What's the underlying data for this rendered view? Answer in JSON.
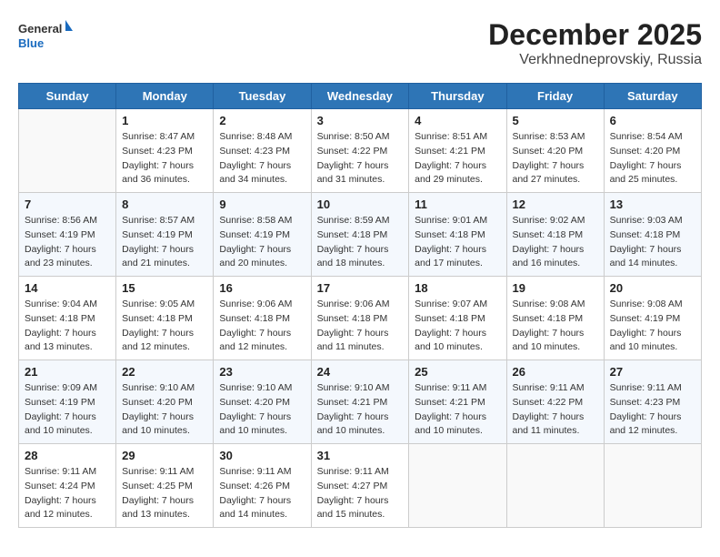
{
  "logo": {
    "general": "General",
    "blue": "Blue"
  },
  "header": {
    "month": "December 2025",
    "location": "Verkhnedneprovskiy, Russia"
  },
  "weekdays": [
    "Sunday",
    "Monday",
    "Tuesday",
    "Wednesday",
    "Thursday",
    "Friday",
    "Saturday"
  ],
  "weeks": [
    [
      {
        "day": "",
        "info": ""
      },
      {
        "day": "1",
        "info": "Sunrise: 8:47 AM\nSunset: 4:23 PM\nDaylight: 7 hours\nand 36 minutes."
      },
      {
        "day": "2",
        "info": "Sunrise: 8:48 AM\nSunset: 4:23 PM\nDaylight: 7 hours\nand 34 minutes."
      },
      {
        "day": "3",
        "info": "Sunrise: 8:50 AM\nSunset: 4:22 PM\nDaylight: 7 hours\nand 31 minutes."
      },
      {
        "day": "4",
        "info": "Sunrise: 8:51 AM\nSunset: 4:21 PM\nDaylight: 7 hours\nand 29 minutes."
      },
      {
        "day": "5",
        "info": "Sunrise: 8:53 AM\nSunset: 4:20 PM\nDaylight: 7 hours\nand 27 minutes."
      },
      {
        "day": "6",
        "info": "Sunrise: 8:54 AM\nSunset: 4:20 PM\nDaylight: 7 hours\nand 25 minutes."
      }
    ],
    [
      {
        "day": "7",
        "info": "Sunrise: 8:56 AM\nSunset: 4:19 PM\nDaylight: 7 hours\nand 23 minutes."
      },
      {
        "day": "8",
        "info": "Sunrise: 8:57 AM\nSunset: 4:19 PM\nDaylight: 7 hours\nand 21 minutes."
      },
      {
        "day": "9",
        "info": "Sunrise: 8:58 AM\nSunset: 4:19 PM\nDaylight: 7 hours\nand 20 minutes."
      },
      {
        "day": "10",
        "info": "Sunrise: 8:59 AM\nSunset: 4:18 PM\nDaylight: 7 hours\nand 18 minutes."
      },
      {
        "day": "11",
        "info": "Sunrise: 9:01 AM\nSunset: 4:18 PM\nDaylight: 7 hours\nand 17 minutes."
      },
      {
        "day": "12",
        "info": "Sunrise: 9:02 AM\nSunset: 4:18 PM\nDaylight: 7 hours\nand 16 minutes."
      },
      {
        "day": "13",
        "info": "Sunrise: 9:03 AM\nSunset: 4:18 PM\nDaylight: 7 hours\nand 14 minutes."
      }
    ],
    [
      {
        "day": "14",
        "info": "Sunrise: 9:04 AM\nSunset: 4:18 PM\nDaylight: 7 hours\nand 13 minutes."
      },
      {
        "day": "15",
        "info": "Sunrise: 9:05 AM\nSunset: 4:18 PM\nDaylight: 7 hours\nand 12 minutes."
      },
      {
        "day": "16",
        "info": "Sunrise: 9:06 AM\nSunset: 4:18 PM\nDaylight: 7 hours\nand 12 minutes."
      },
      {
        "day": "17",
        "info": "Sunrise: 9:06 AM\nSunset: 4:18 PM\nDaylight: 7 hours\nand 11 minutes."
      },
      {
        "day": "18",
        "info": "Sunrise: 9:07 AM\nSunset: 4:18 PM\nDaylight: 7 hours\nand 10 minutes."
      },
      {
        "day": "19",
        "info": "Sunrise: 9:08 AM\nSunset: 4:18 PM\nDaylight: 7 hours\nand 10 minutes."
      },
      {
        "day": "20",
        "info": "Sunrise: 9:08 AM\nSunset: 4:19 PM\nDaylight: 7 hours\nand 10 minutes."
      }
    ],
    [
      {
        "day": "21",
        "info": "Sunrise: 9:09 AM\nSunset: 4:19 PM\nDaylight: 7 hours\nand 10 minutes."
      },
      {
        "day": "22",
        "info": "Sunrise: 9:10 AM\nSunset: 4:20 PM\nDaylight: 7 hours\nand 10 minutes."
      },
      {
        "day": "23",
        "info": "Sunrise: 9:10 AM\nSunset: 4:20 PM\nDaylight: 7 hours\nand 10 minutes."
      },
      {
        "day": "24",
        "info": "Sunrise: 9:10 AM\nSunset: 4:21 PM\nDaylight: 7 hours\nand 10 minutes."
      },
      {
        "day": "25",
        "info": "Sunrise: 9:11 AM\nSunset: 4:21 PM\nDaylight: 7 hours\nand 10 minutes."
      },
      {
        "day": "26",
        "info": "Sunrise: 9:11 AM\nSunset: 4:22 PM\nDaylight: 7 hours\nand 11 minutes."
      },
      {
        "day": "27",
        "info": "Sunrise: 9:11 AM\nSunset: 4:23 PM\nDaylight: 7 hours\nand 12 minutes."
      }
    ],
    [
      {
        "day": "28",
        "info": "Sunrise: 9:11 AM\nSunset: 4:24 PM\nDaylight: 7 hours\nand 12 minutes."
      },
      {
        "day": "29",
        "info": "Sunrise: 9:11 AM\nSunset: 4:25 PM\nDaylight: 7 hours\nand 13 minutes."
      },
      {
        "day": "30",
        "info": "Sunrise: 9:11 AM\nSunset: 4:26 PM\nDaylight: 7 hours\nand 14 minutes."
      },
      {
        "day": "31",
        "info": "Sunrise: 9:11 AM\nSunset: 4:27 PM\nDaylight: 7 hours\nand 15 minutes."
      },
      {
        "day": "",
        "info": ""
      },
      {
        "day": "",
        "info": ""
      },
      {
        "day": "",
        "info": ""
      }
    ]
  ]
}
